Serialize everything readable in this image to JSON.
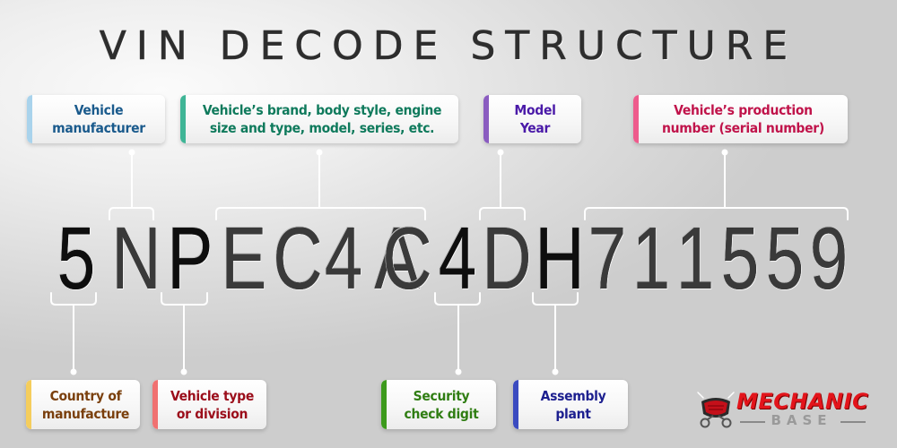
{
  "title": "VIN DECODE STRUCTURE",
  "vin": {
    "value": "5NPEC4AC4DH711559",
    "characters": [
      "5",
      "N",
      "P",
      "E",
      "C",
      "4",
      "A",
      "C",
      "4",
      "D",
      "H",
      "7",
      "1",
      "1",
      "5",
      "5",
      "9"
    ]
  },
  "top_labels": [
    {
      "id": "manufacturer",
      "text": "Vehicle\nmanufacturer",
      "color": "#1a5a8c",
      "accent": "#a9d3ec",
      "positions": "2"
    },
    {
      "id": "descriptor",
      "text": "Vehicle’s brand, body style, engine\nsize and type, model, series, etc.",
      "color": "#0f7a5c",
      "accent": "#3fb596",
      "positions": "4-8"
    },
    {
      "id": "model-year",
      "text": "Model\nYear",
      "color": "#4a1aa8",
      "accent": "#8a5cc0",
      "positions": "10"
    },
    {
      "id": "serial",
      "text": "Vehicle’s production\nnumber (serial number)",
      "color": "#c0134a",
      "accent": "#ee5b8c",
      "positions": "12-17"
    }
  ],
  "bottom_labels": [
    {
      "id": "country",
      "text": "Country of\nmanufacture",
      "color": "#7a3f0c",
      "accent": "#f5cd5c",
      "positions": "1"
    },
    {
      "id": "vehicle-type",
      "text": "Vehicle type\nor division",
      "color": "#9b0d1a",
      "accent": "#f07171",
      "positions": "3"
    },
    {
      "id": "check-digit",
      "text": "Security\ncheck digit",
      "color": "#2f7d12",
      "accent": "#3c9a1c",
      "positions": "9"
    },
    {
      "id": "assembly-plant",
      "text": "Assembly\nplant",
      "color": "#1c1f8f",
      "accent": "#3b4bc0",
      "positions": "11"
    }
  ],
  "logo": {
    "name": "MECHANIC",
    "sub": "BASE",
    "color": "#e3141b"
  }
}
